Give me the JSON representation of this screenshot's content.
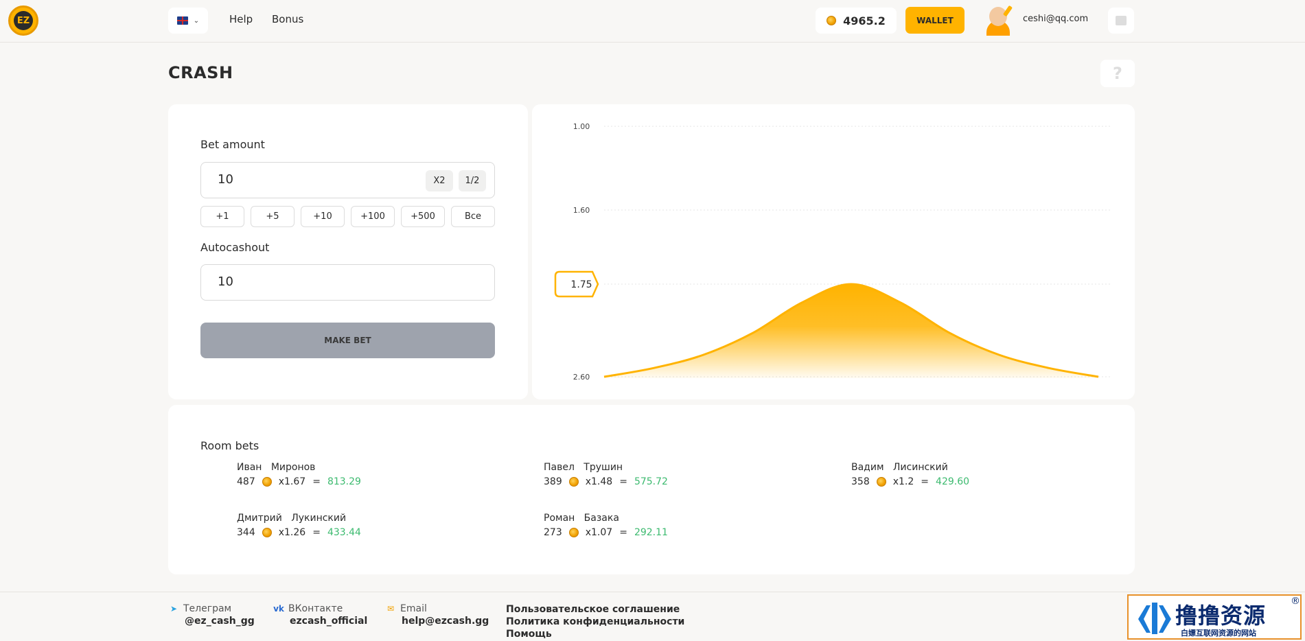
{
  "header": {
    "logo_text": "EZ",
    "nav": {
      "help": "Help",
      "bonus": "Bonus"
    },
    "balance": "4965.2",
    "wallet_label": "WALLET",
    "user_email": "ceshi@qq.com"
  },
  "page": {
    "title": "CRASH",
    "help_glyph": "?"
  },
  "bet_panel": {
    "bet_amount_label": "Bet amount",
    "bet_amount_value": "10",
    "x2_label": "X2",
    "half_label": "1/2",
    "quick_buttons": [
      "+1",
      "+5",
      "+10",
      "+100",
      "+500",
      "Все"
    ],
    "autocashout_label": "Autocashout",
    "autocashout_value": "10",
    "make_bet_label": "MAKE BET"
  },
  "chart_data": {
    "type": "area",
    "y_tick_labels": [
      "1.00",
      "1.60",
      "2.60"
    ],
    "current_multiplier": "1.75",
    "x": [
      0,
      0.1,
      0.2,
      0.3,
      0.4,
      0.5,
      0.6,
      0.7,
      0.8,
      0.9,
      1.0
    ],
    "y": [
      2.6,
      2.52,
      2.4,
      2.2,
      1.92,
      1.75,
      1.92,
      2.2,
      2.4,
      2.52,
      2.6
    ],
    "color": "#ffb300",
    "grid": true
  },
  "room_bets": {
    "title": "Room bets",
    "items": [
      {
        "first": "Иван",
        "last": "Миронов",
        "amount": "487",
        "mult": "x1.67",
        "eq": "=",
        "result": "813.29"
      },
      {
        "first": "Павел",
        "last": "Трушин",
        "amount": "389",
        "mult": "x1.48",
        "eq": "=",
        "result": "575.72"
      },
      {
        "first": "Вадим",
        "last": "Лисинский",
        "amount": "358",
        "mult": "x1.2",
        "eq": "=",
        "result": "429.60"
      },
      {
        "first": "Дмитрий",
        "last": "Лукинский",
        "amount": "344",
        "mult": "x1.26",
        "eq": "=",
        "result": "433.44"
      },
      {
        "first": "Роман",
        "last": "Базака",
        "amount": "273",
        "mult": "x1.07",
        "eq": "=",
        "result": "292.11"
      }
    ]
  },
  "footer": {
    "telegram_label": "Телеграм",
    "telegram_value": "@ez_cash_gg",
    "vk_label": "ВКонтакте",
    "vk_value": "ezcash_official",
    "email_label": "Email",
    "email_value": "help@ezcash.gg",
    "links": [
      "Пользовательское соглашение",
      "Политика конфиденциальности",
      "Помощь"
    ]
  },
  "watermark": {
    "title": "撸撸资源",
    "subtitle": "白嫖互联网资源的网站",
    "reg": "®"
  }
}
